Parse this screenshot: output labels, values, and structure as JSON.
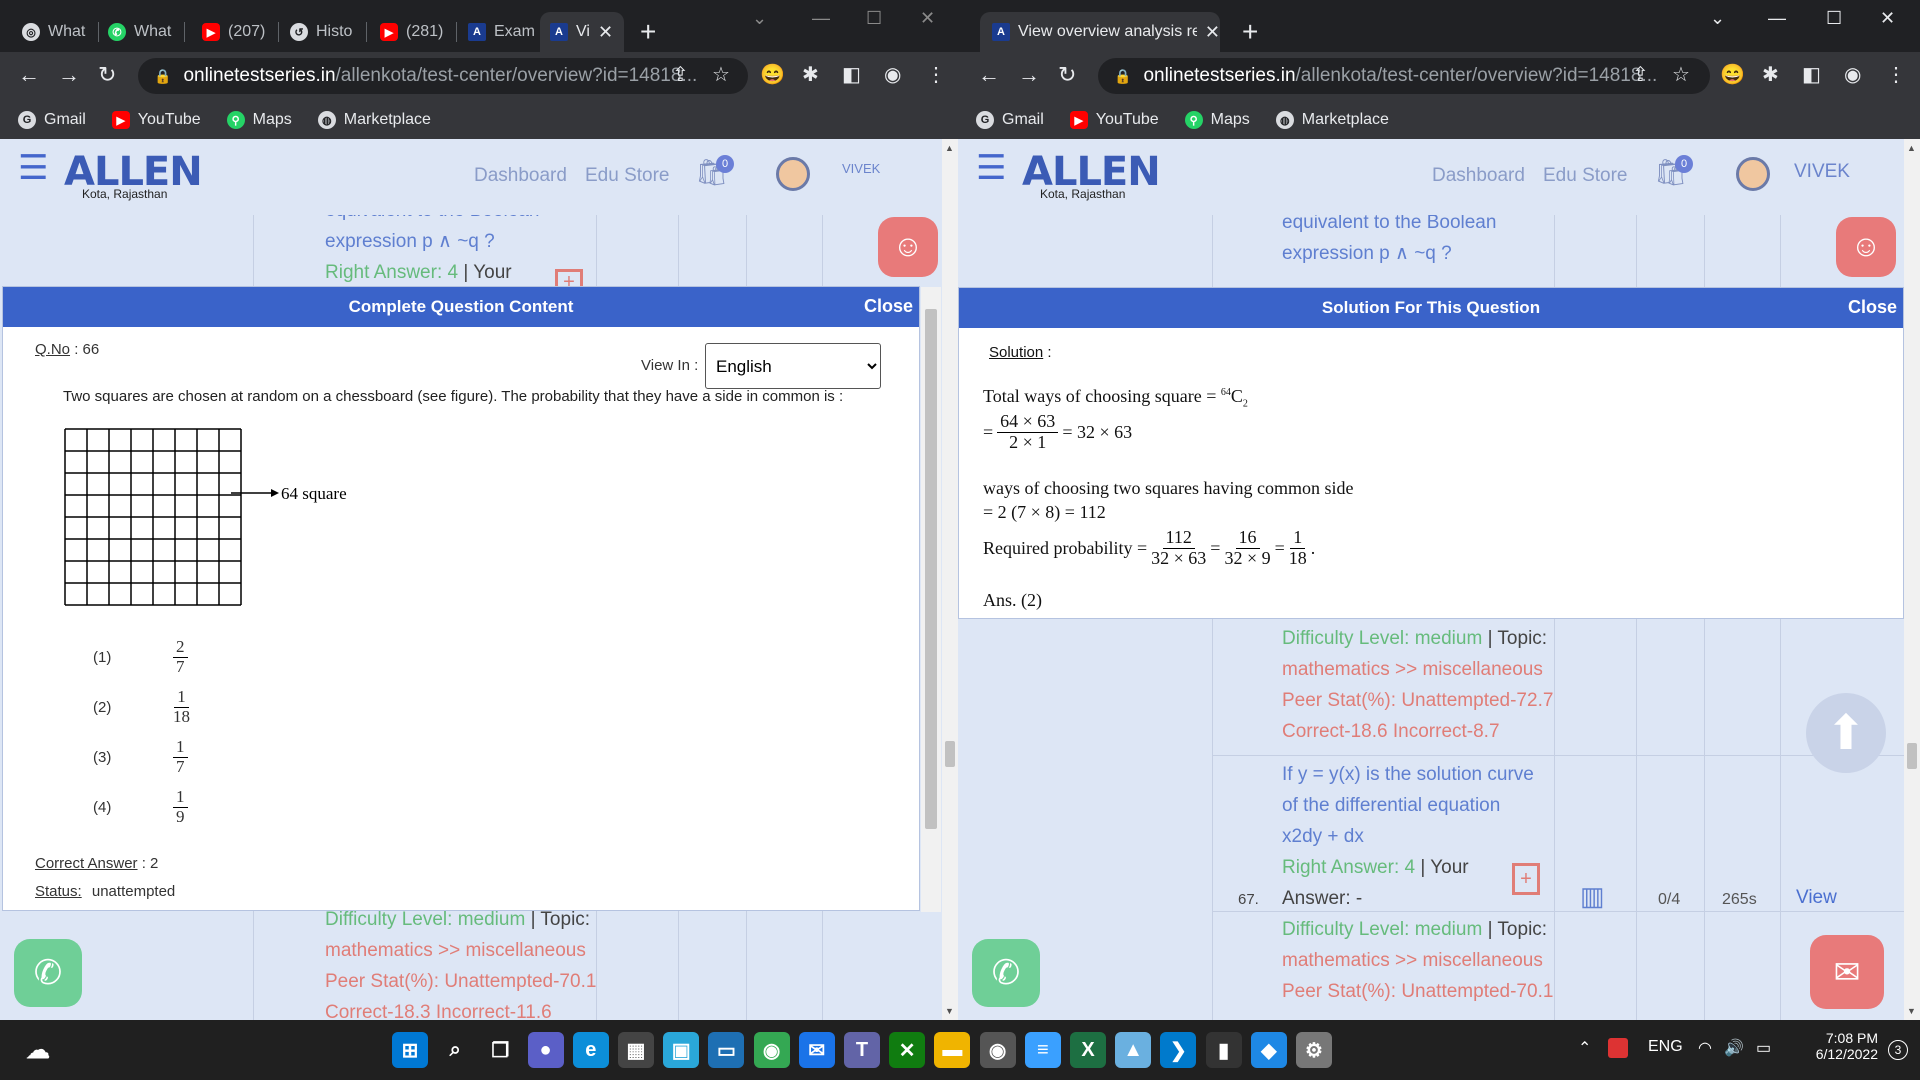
{
  "left_window": {
    "tabs": [
      {
        "label": "What",
        "icon": "chrome-icon"
      },
      {
        "label": "What",
        "icon": "whatsapp-icon"
      },
      {
        "label": "(207)",
        "icon": "youtube-icon"
      },
      {
        "label": "Histo",
        "icon": "history-icon"
      },
      {
        "label": "(281)",
        "icon": "youtube-icon"
      },
      {
        "label": "Exam",
        "icon": "allen-icon"
      },
      {
        "label": "Vi",
        "icon": "allen-icon",
        "active": true
      }
    ],
    "url_host": "onlinetestseries.in",
    "url_path": "/allenkota/test-center/overview?id=14818...",
    "modal_title": "Complete Question Content",
    "modal_close": "Close",
    "q_no_label": "Q.No",
    "q_no_value": ": 66",
    "view_in_label": "View In :",
    "language": "English",
    "language_options": [
      "English"
    ],
    "question_text": "Two squares are chosen at random on a chessboard (see figure). The probability that they have a side in common is :",
    "figure_label": "64 square",
    "options": [
      {
        "label": "(1)",
        "num": "2",
        "den": "7"
      },
      {
        "label": "(2)",
        "num": "1",
        "den": "18"
      },
      {
        "label": "(3)",
        "num": "1",
        "den": "7"
      },
      {
        "label": "(4)",
        "num": "1",
        "den": "9"
      }
    ],
    "correct_answer_label": "Correct Answer",
    "correct_answer_value": ": 2",
    "status_label": "Status:",
    "status_value": "unattempted",
    "bg_top_lines": [
      "equivalent to the Boolean",
      "expression p ∧ ~q ?",
      "Right Answer: 4 | Your"
    ],
    "bg_bottom_lines": [
      "Difficulty Level: medium | Topic:",
      "mathematics >> miscellaneous",
      "Peer Stat(%): Unattempted-70.1",
      "Correct-18.3 Incorrect-11.6"
    ],
    "username": "VIVEK"
  },
  "right_window": {
    "tab_title": "View overview analysis report of",
    "url_host": "onlinetestseries.in",
    "url_path": "/allenkota/test-center/overview?id=14818...",
    "modal_title": "Solution For This Question",
    "modal_close": "Close",
    "solution_label": "Solution",
    "solution_colon": ":",
    "sol_line1": "Total ways of choosing square = ",
    "sol_line1_sup": "64",
    "sol_line1_c": "C",
    "sol_line1_sub": "2",
    "sol_frac_num": "64 × 63",
    "sol_frac_den": "2 × 1",
    "sol_frac_rest": "= 32 × 63",
    "sol_line3": "ways of choosing two squares having common side",
    "sol_line4": "= 2 (7 × 8) = 112",
    "sol_req_label": "Required probability =",
    "sol_f1_num": "112",
    "sol_f1_den": "32 × 63",
    "sol_f2_num": "16",
    "sol_f2_den": "32 × 9",
    "sol_f3_num": "1",
    "sol_f3_den": "18",
    "sol_ans": "Ans. (2)",
    "bg_top_lines": [
      "equivalent to the Boolean",
      "expression p ∧ ~q ?",
      "Right Answer: 4 | Your"
    ],
    "row_66_lines": [
      "Difficulty Level: medium | Topic:",
      "mathematics >> miscellaneous",
      "Peer Stat(%): Unattempted-72.7",
      "Correct-18.6 Incorrect-8.7"
    ],
    "row_67": {
      "number": "67.",
      "lines": [
        "If y = y(x) is the solution curve",
        "of the differential equation",
        "x2dy + dx",
        "Right Answer: 4 | Your",
        "Answer: -"
      ],
      "marks": "0/4",
      "time": "265s",
      "view": "View"
    },
    "row_67_bottom_lines": [
      "Difficulty Level: medium | Topic:",
      "mathematics >> miscellaneous",
      "Peer Stat(%): Unattempted-70.1"
    ],
    "username": "VIVEK"
  },
  "site": {
    "logo": "ALLEN",
    "logo_sub": "Kota, Rajasthan",
    "nav_dashboard": "Dashboard",
    "nav_edustore": "Edu Store",
    "cart_count": "0"
  },
  "bookmarks": [
    {
      "label": "Gmail",
      "icon": "google-icon"
    },
    {
      "label": "YouTube",
      "icon": "youtube-icon"
    },
    {
      "label": "Maps",
      "icon": "maps-icon"
    },
    {
      "label": "Marketplace",
      "icon": "marketplace-icon"
    }
  ],
  "taskbar": {
    "lang": "ENG",
    "time": "7:08 PM",
    "date": "6/12/2022",
    "notif_count": "3"
  },
  "colors": {
    "accent_blue": "#3a63c9",
    "page_bg": "#dde6f5",
    "chrome_dark": "#202124",
    "chrome_toolbar": "#35363a",
    "fab_red": "#e87a7a",
    "whatsapp_green": "#6fcf97"
  }
}
